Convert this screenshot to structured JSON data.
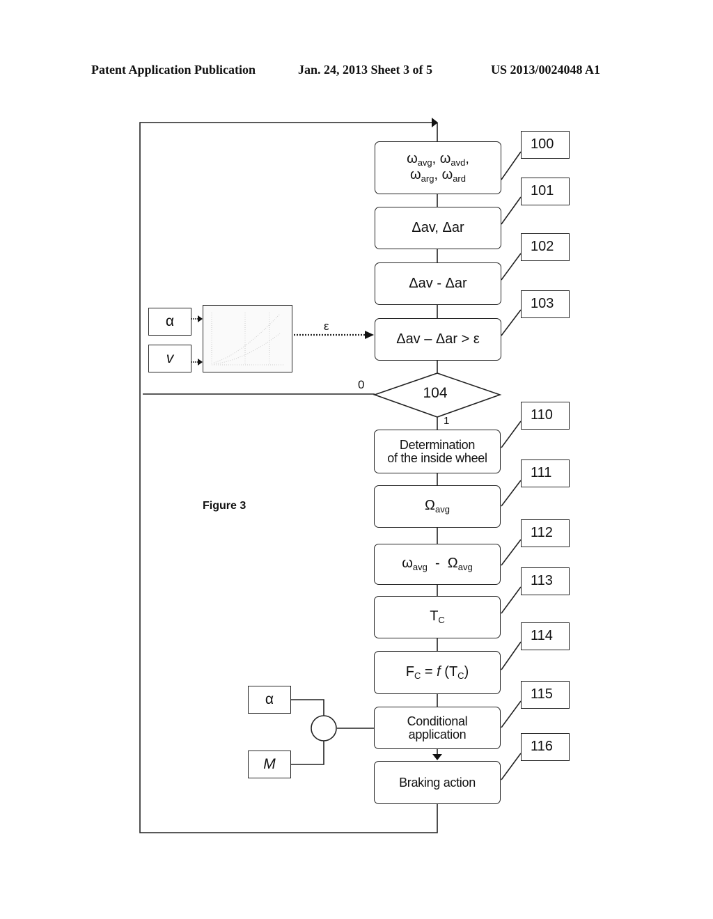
{
  "header": {
    "publication": "Patent Application Publication",
    "date_sheet": "Jan. 24, 2013  Sheet 3 of 5",
    "number": "US 2013/0024048 A1"
  },
  "figure_label": "Figure 3",
  "steps": [
    {
      "ref": "100",
      "line1": "ω",
      "sub1": "avg",
      "text": "ωavg, ωavd, ωarg, ωard"
    },
    {
      "ref": "101",
      "text": "Δav, Δar"
    },
    {
      "ref": "102",
      "text": "Δav - Δar"
    },
    {
      "ref": "103",
      "text": "Δav – Δar > ε"
    },
    {
      "ref": "104",
      "text": "104"
    },
    {
      "ref": "110",
      "line1": "Determination",
      "line2": "of the inside wheel"
    },
    {
      "ref": "111",
      "text": "Ωavg"
    },
    {
      "ref": "112",
      "text": "ωavg - Ωavg"
    },
    {
      "ref": "113",
      "text": "TC"
    },
    {
      "ref": "114",
      "text": "FC = f (TC)"
    },
    {
      "ref": "115",
      "line1": "Conditional",
      "line2": "application"
    },
    {
      "ref": "116",
      "text": "Braking action"
    }
  ],
  "symbols": {
    "omega": "ω",
    "Omega": "Ω",
    "comma": ",",
    "minus": "-",
    "dash": "–",
    "gt_eps": "> ε",
    "delta_av": "Δav",
    "delta_ar": "Δar",
    "sub_avg": "avg",
    "sub_avd": "avd",
    "sub_arg": "arg",
    "sub_ard": "ard",
    "T": "T",
    "F": "F",
    "sub_c": "C",
    "eq_f": " = ",
    "f": "f",
    "open": " (",
    "close": ")"
  },
  "inputs": {
    "map_inputs": [
      "α",
      "v"
    ],
    "map_output": "ε",
    "combine_inputs": [
      "α",
      "M"
    ]
  },
  "branch_labels": {
    "no": "0",
    "yes": "1"
  }
}
